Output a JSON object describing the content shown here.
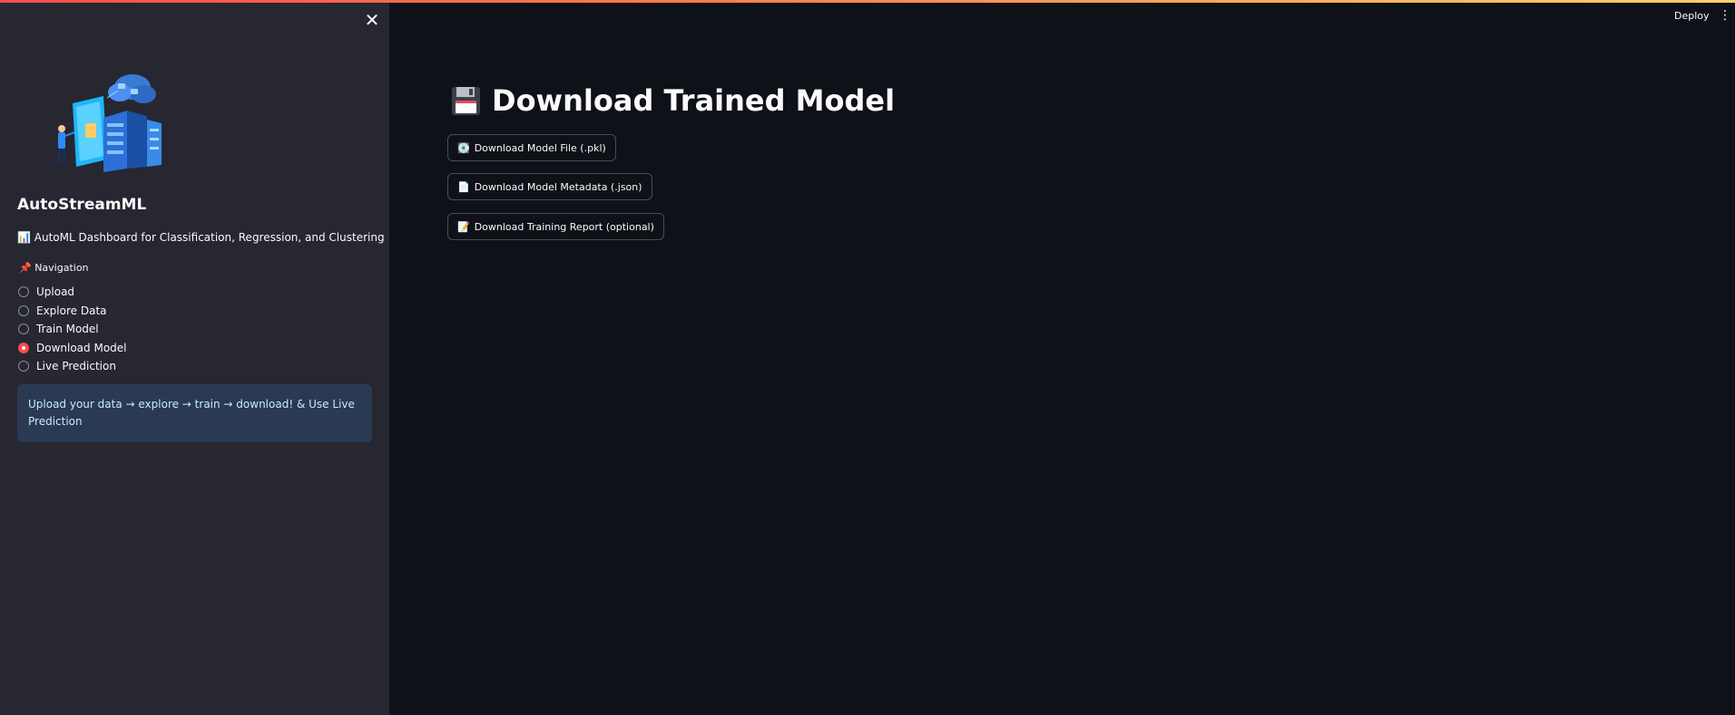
{
  "header": {
    "deploy_label": "Deploy",
    "menu_icon": "more-vertical-icon"
  },
  "sidebar": {
    "close_icon": "close-icon",
    "app_title": "AutoStreamML",
    "subtitle_icon": "📊",
    "subtitle": "AutoML Dashboard for Classification, Regression, and Clustering",
    "nav_icon": "📌",
    "nav_label": "Navigation",
    "nav_items": [
      {
        "label": "Upload",
        "selected": false
      },
      {
        "label": "Explore Data",
        "selected": false
      },
      {
        "label": "Train Model",
        "selected": false
      },
      {
        "label": "Download Model",
        "selected": true
      },
      {
        "label": "Live Prediction",
        "selected": false
      }
    ],
    "info_text": "Upload your data → explore → train → download! & Use Live Prediction"
  },
  "main": {
    "title_icon": "floppy-disk-icon",
    "title": "Download Trained Model",
    "buttons": [
      {
        "icon": "💽",
        "label": "Download Model File (.pkl)"
      },
      {
        "icon": "📄",
        "label": "Download Model Metadata (.json)"
      },
      {
        "icon": "📝",
        "label": "Download Training Report (optional)"
      }
    ]
  },
  "colors": {
    "accent": "#ff4b4b",
    "background": "#0e1117",
    "sidebar_bg": "#262730",
    "info_bg": "#293a52"
  }
}
